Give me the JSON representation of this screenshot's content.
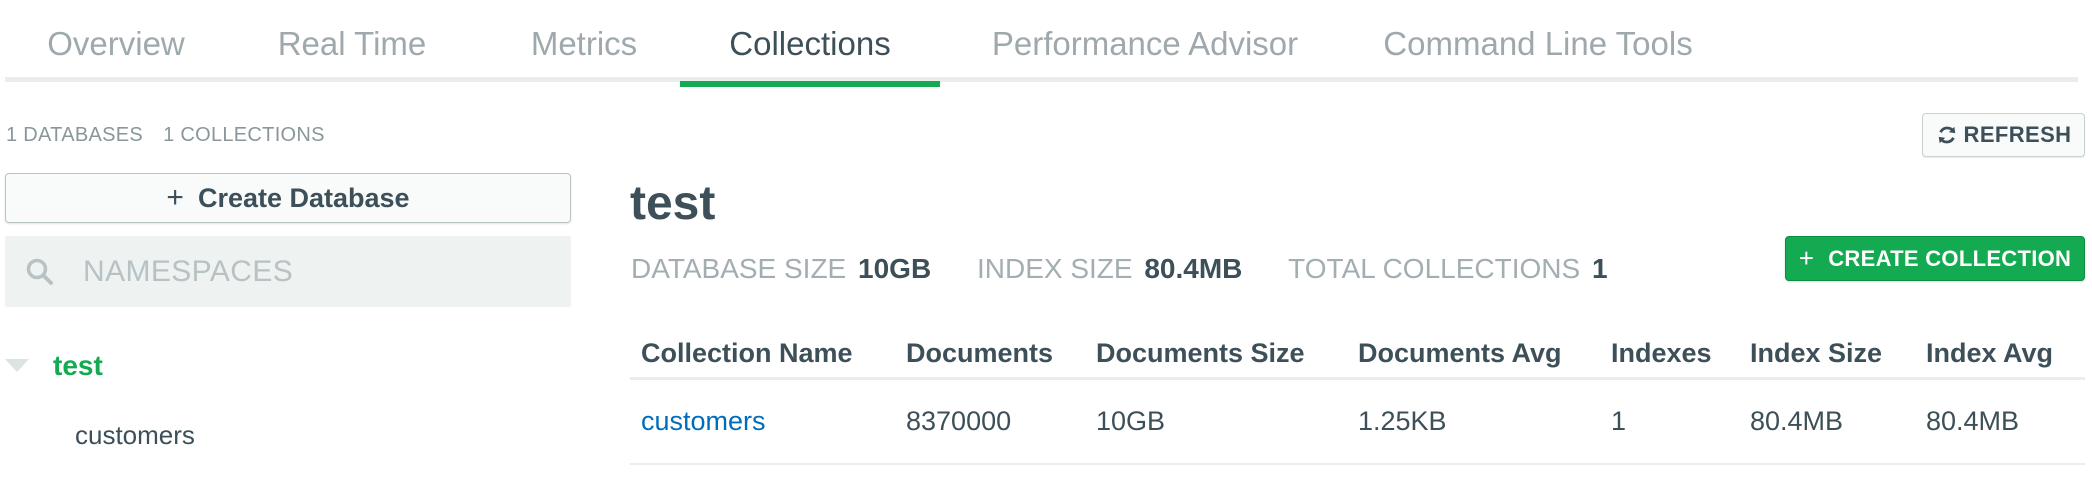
{
  "tabs": [
    {
      "label": "Overview",
      "active": false
    },
    {
      "label": "Real Time",
      "active": false
    },
    {
      "label": "Metrics",
      "active": false
    },
    {
      "label": "Collections",
      "active": true
    },
    {
      "label": "Performance Advisor",
      "active": false
    },
    {
      "label": "Command Line Tools",
      "active": false
    }
  ],
  "stats": {
    "databases": "1 DATABASES",
    "collections": "1 COLLECTIONS"
  },
  "refresh": {
    "label": "REFRESH",
    "icon": "refresh-icon"
  },
  "sidebar": {
    "create_database_label": "Create Database",
    "search_placeholder": "NAMESPACES",
    "tree": [
      {
        "name": "test",
        "expanded": true,
        "collections": [
          "customers"
        ]
      }
    ]
  },
  "main": {
    "title": "test",
    "meta": [
      {
        "label": "DATABASE SIZE",
        "value": "10GB"
      },
      {
        "label": "INDEX SIZE",
        "value": "80.4MB"
      },
      {
        "label": "TOTAL COLLECTIONS",
        "value": "1"
      }
    ],
    "create_collection_label": "CREATE COLLECTION",
    "table": {
      "columns": [
        "Collection Name",
        "Documents",
        "Documents Size",
        "Documents Avg",
        "Indexes",
        "Index Size",
        "Index Avg"
      ],
      "rows": [
        [
          "customers",
          "8370000",
          "10GB",
          "1.25KB",
          "1",
          "80.4MB",
          "80.4MB"
        ]
      ]
    }
  },
  "colors": {
    "accent_green": "#13aa52",
    "link_blue": "#006cbc",
    "text_dark": "#3d4f58",
    "text_muted": "#9fa9ad"
  }
}
